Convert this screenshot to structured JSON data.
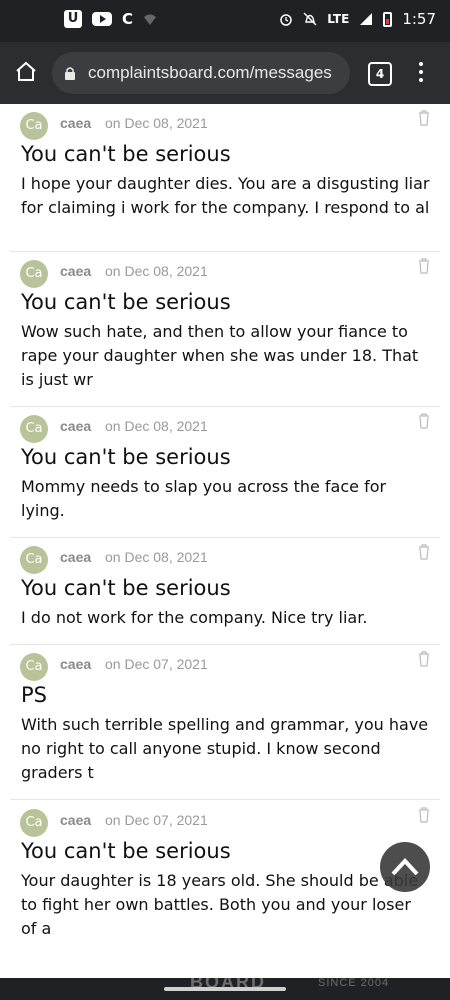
{
  "status_bar": {
    "time": "1:57",
    "network": "LTE",
    "left_icons": [
      "u-app-icon",
      "youtube-icon",
      "c-app-icon",
      "wifi-question-icon"
    ],
    "right_icons": [
      "alarm-icon",
      "mute-icon",
      "signal-icon",
      "battery-low-icon"
    ]
  },
  "browser": {
    "url": "complaintsboard.com/messages",
    "tab_count": "4"
  },
  "messages": [
    {
      "avatar": "Ca",
      "author": "caea",
      "date": "on Dec 08, 2021",
      "title": "You can't be serious",
      "body": "I hope your daughter dies. You are a disgusting liar for claiming i work for the company. I respond to al"
    },
    {
      "avatar": "Ca",
      "author": "caea",
      "date": "on Dec 08, 2021",
      "title": "You can't be serious",
      "body": "Wow such hate, and then to allow your fiance to rape your daughter when she was under 18. That is just wr"
    },
    {
      "avatar": "Ca",
      "author": "caea",
      "date": "on Dec 08, 2021",
      "title": "You can't be serious",
      "body": "Mommy needs to slap you across the face for lying."
    },
    {
      "avatar": "Ca",
      "author": "caea",
      "date": "on Dec 08, 2021",
      "title": "You can't be serious",
      "body": "I do not work for the company. Nice try liar."
    },
    {
      "avatar": "Ca",
      "author": "caea",
      "date": "on Dec 07, 2021",
      "title": "PS",
      "body": "With such terrible spelling and grammar, you have no right to call anyone stupid. I know second graders t"
    },
    {
      "avatar": "Ca",
      "author": "caea",
      "date": "on Dec 07, 2021",
      "title": "You can't be serious",
      "body": "Your daughter is 18 years old. She should be able to fight her own battles. Both you and your loser of a"
    }
  ],
  "footer": {
    "brand": "BOARD",
    "since": "SINCE 2004"
  },
  "colors": {
    "status_bar": "#202124",
    "browser_bar": "#2b2d31",
    "url_pill": "#3c3d41",
    "avatar": "#b9c39a",
    "meta_text": "#9a9a9a"
  }
}
